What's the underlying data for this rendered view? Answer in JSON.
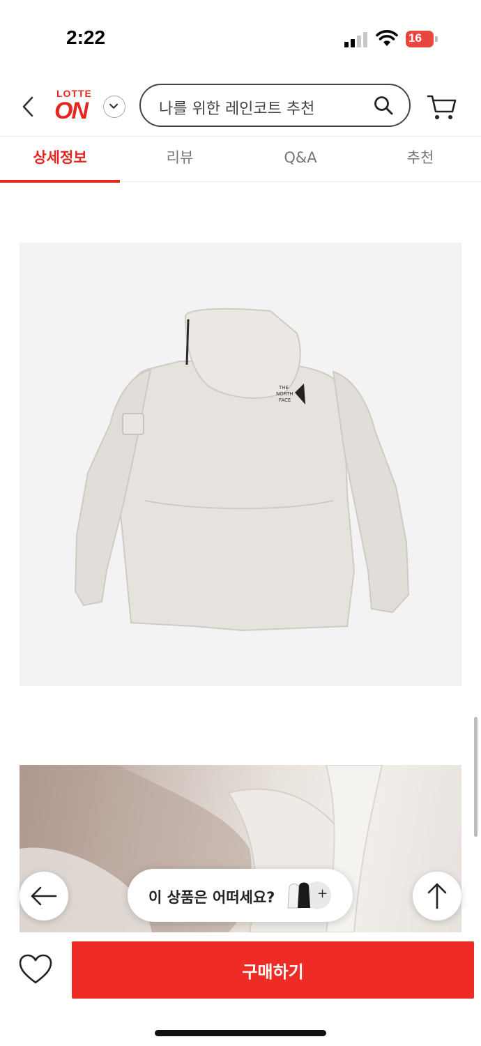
{
  "status_bar": {
    "time": "2:22",
    "battery": "16"
  },
  "header": {
    "logo_top": "LOTTE",
    "logo_main": "ON",
    "search_placeholder": "나를 위한 레인코트 추천"
  },
  "tabs": [
    {
      "label": "상세정보",
      "active": true
    },
    {
      "label": "리뷰",
      "active": false
    },
    {
      "label": "Q&A",
      "active": false
    },
    {
      "label": "추천",
      "active": false
    }
  ],
  "floating": {
    "recommend_text": "이 상품은 어떠세요?",
    "plus": "+"
  },
  "bottom": {
    "buy_label": "구매하기"
  },
  "colors": {
    "accent": "#e4261e",
    "buy_button": "#ee2b24"
  },
  "icons": [
    "back-arrow-icon",
    "chevron-down-icon",
    "search-icon",
    "cart-icon",
    "arrow-left-icon",
    "arrow-up-icon",
    "heart-icon"
  ]
}
